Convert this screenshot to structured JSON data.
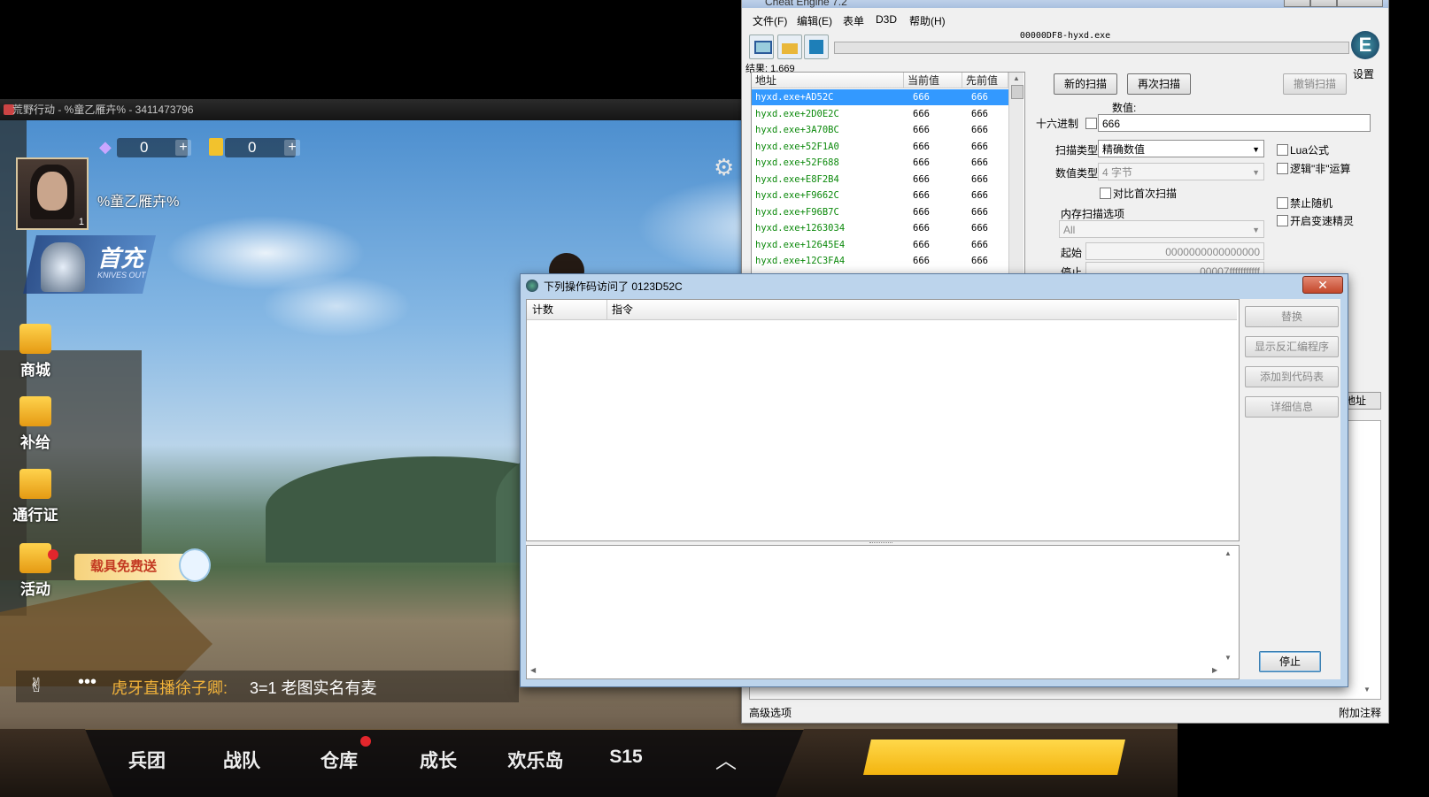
{
  "game": {
    "title": "荒野行动 - %童乙雁卉% - 3411473796",
    "username": "%童乙雁卉%",
    "avatar_level": "1",
    "diamonds": "0",
    "coins": "0",
    "first_charge": {
      "title": "首充",
      "subtitle": "KNIVES OUT"
    },
    "side_buttons": [
      {
        "label": "商城",
        "icon": "shop-icon"
      },
      {
        "label": "补给",
        "icon": "supply-icon"
      },
      {
        "label": "通行证",
        "icon": "pass-icon"
      },
      {
        "label": "活动",
        "icon": "gift-icon"
      }
    ],
    "vehicle_free": "载具免费送",
    "ticker": {
      "dots": "•••",
      "who": "虎牙直播徐子卿:",
      "message": "3=1  老图实名有麦"
    },
    "nav": [
      "兵团",
      "战队",
      "仓库",
      "成长",
      "欢乐岛",
      "S15"
    ]
  },
  "ce": {
    "title": "Cheat Engine 7.2",
    "menu": [
      "文件(F)",
      "编辑(E)",
      "表单",
      "D3D",
      "帮助(H)"
    ],
    "process": "00000DF8-hyxd.exe",
    "settings_label": "设置",
    "results": "结果: 1,669",
    "columns": [
      "地址",
      "当前值",
      "先前值"
    ],
    "rows": [
      {
        "address": "hyxd.exe+AD52C",
        "current": "666",
        "previous": "666"
      },
      {
        "address": "hyxd.exe+2D0E2C",
        "current": "666",
        "previous": "666"
      },
      {
        "address": "hyxd.exe+3A70BC",
        "current": "666",
        "previous": "666"
      },
      {
        "address": "hyxd.exe+52F1A0",
        "current": "666",
        "previous": "666"
      },
      {
        "address": "hyxd.exe+52F688",
        "current": "666",
        "previous": "666"
      },
      {
        "address": "hyxd.exe+E8F2B4",
        "current": "666",
        "previous": "666"
      },
      {
        "address": "hyxd.exe+F9662C",
        "current": "666",
        "previous": "666"
      },
      {
        "address": "hyxd.exe+F96B7C",
        "current": "666",
        "previous": "666"
      },
      {
        "address": "hyxd.exe+1263034",
        "current": "666",
        "previous": "666"
      },
      {
        "address": "hyxd.exe+12645E4",
        "current": "666",
        "previous": "666"
      },
      {
        "address": "hyxd.exe+12C3FA4",
        "current": "666",
        "previous": "666"
      }
    ],
    "new_scan": "新的扫描",
    "next_scan": "再次扫描",
    "undo_scan": "撤销扫描",
    "value_label": "数值:",
    "hex_label": "十六进制",
    "value": "666",
    "scan_type_label": "扫描类型",
    "scan_type": "精确数值",
    "value_type_label": "数值类型",
    "value_type": "4 字节",
    "compare_first": "对比首次扫描",
    "lua_formula": "Lua公式",
    "logic_not": "逻辑\"非\"运算",
    "disable_random": "禁止随机",
    "speedhack": "开启变速精灵",
    "mem_scan_options": "内存扫描选项",
    "region": "All",
    "start_label": "起始",
    "start_value": "0000000000000000",
    "stop_label": "停止",
    "stop_value": "00007fffffffffff",
    "add_address_partial": "地址",
    "advanced_options": "高级选项",
    "attach_notes": "附加注释"
  },
  "dialog": {
    "title": "下列操作码访问了 0123D52C",
    "columns": [
      "计数",
      "指令"
    ],
    "replace": "替换",
    "show_disassembler": "显示反汇编程序",
    "add_to_codelist": "添加到代码表",
    "details": "详细信息",
    "stop": "停止"
  }
}
